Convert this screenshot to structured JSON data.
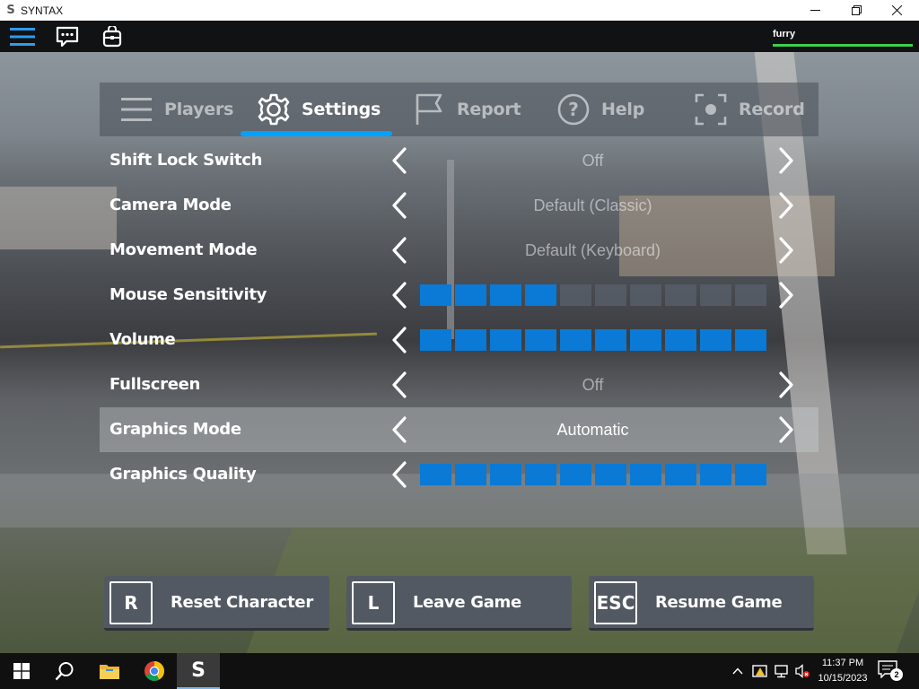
{
  "window": {
    "title": "SYNTAX",
    "controls": [
      "minimize",
      "restore",
      "close"
    ]
  },
  "topbar": {
    "icons": [
      "menu-icon",
      "chat-icon",
      "backpack-icon"
    ],
    "username": "furry"
  },
  "tabs": [
    {
      "label": "Players",
      "icon": "players-icon",
      "active": false
    },
    {
      "label": "Settings",
      "icon": "gear-icon",
      "active": true
    },
    {
      "label": "Report",
      "icon": "flag-icon",
      "active": false
    },
    {
      "label": "Help",
      "icon": "help-icon",
      "active": false
    },
    {
      "label": "Record",
      "icon": "record-icon",
      "active": false
    }
  ],
  "settings": [
    {
      "label": "Shift Lock Switch",
      "type": "option",
      "value": "Off"
    },
    {
      "label": "Camera Mode",
      "type": "option",
      "value": "Default (Classic)"
    },
    {
      "label": "Movement Mode",
      "type": "option",
      "value": "Default (Keyboard)"
    },
    {
      "label": "Mouse Sensitivity",
      "type": "slider",
      "level": 4,
      "max": 10
    },
    {
      "label": "Volume",
      "type": "slider",
      "level": 10,
      "max": 10
    },
    {
      "label": "Fullscreen",
      "type": "option",
      "value": "Off"
    },
    {
      "label": "Graphics Mode",
      "type": "option",
      "value": "Automatic",
      "selected": true
    },
    {
      "label": "Graphics Quality",
      "type": "slider",
      "level": 10,
      "max": 10
    }
  ],
  "actions": [
    {
      "key": "R",
      "label": "Reset Character"
    },
    {
      "key": "L",
      "label": "Leave Game"
    },
    {
      "key": "ESC",
      "label": "Resume Game"
    }
  ],
  "taskbar": {
    "apps": [
      "start-icon",
      "search-icon",
      "file-explorer-icon",
      "chrome-icon",
      "syntax-app-icon"
    ],
    "time": "11:37 PM",
    "date": "10/15/2023",
    "notification_count": "2"
  },
  "colors": {
    "accent": "#00a2ff",
    "slider_on": "#0a7ad6",
    "health": "#3ecf4a"
  }
}
